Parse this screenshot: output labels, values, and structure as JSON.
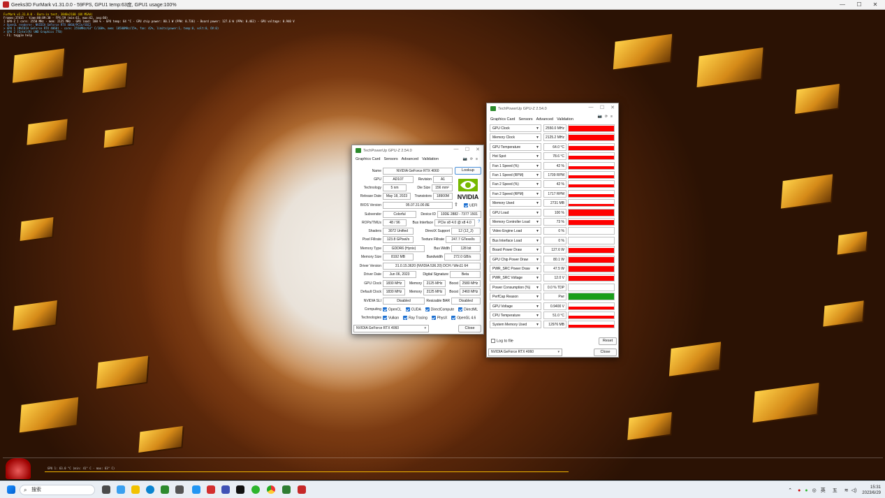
{
  "furmark": {
    "title": "Geeks3D FurMark v1.31.0.0 - 59FPS, GPU1 temp:63度, GPU1 usage:100%",
    "overlay": [
      {
        "text": "FurMark v1.31.0.0 - Burn-in test, 3840x2160 (0X MSAA)",
        "color": "#ffe600"
      },
      {
        "text": "Frames:37415 - time:00:09:30 - FPS:59 (min:61, max:62, avg:60)",
        "color": "#ffffff"
      },
      {
        "text": "[ GPU-Z ] core: 2550 MHz - mem: 2125 MHz - GPU load: 100 % - GPU temp: 64 °C - GPU chip power: 80.1 W (PPW: 0.736) - Board power: 127.6 W (PPW: 0.462) - GPU voltage: 0.940 V",
        "color": "#ffffff"
      },
      {
        "text": "> OpenGL renderer: NVIDIA GeForce RTX 4060/PCIe/SSE2",
        "color": "#66b3ff"
      },
      {
        "text": "> GPU 1 (NVIDIA GeForce RTX 4060) - core: 2550MHz/63° C/100%, mem: 10500MHz/15%, fan: 42%, limits(power:1, temp:0, volt:0, OV:0)",
        "color": "#66ccff"
      },
      {
        "text": "> GPU 2 (Intel(R) UHD Graphics 770)",
        "color": "#66ccff"
      },
      {
        "text": "- F1: toggle help",
        "color": "#ffffff"
      }
    ],
    "graph_label": "GPU 1: 63.0 °C (min: 41° C - max: 63° C)",
    "window_controls": [
      "—",
      "☐",
      "✕"
    ]
  },
  "gpuz_card": {
    "title": "TechPowerUp GPU-Z 2.54.0",
    "tabs": [
      "Graphics Card",
      "Sensors",
      "Advanced",
      "Validation"
    ],
    "active_tab": "Graphics Card",
    "name": "NVIDIA GeForce RTX 4060",
    "lookup": "Lookup",
    "gpu": "AD107",
    "revision_label": "Revision",
    "revision": "A1",
    "technology": "5 nm",
    "die_size_label": "Die Size",
    "die_size": "156 mm²",
    "release_date": "May 18, 2023",
    "transistors_label": "Transistors",
    "transistors": "18900M",
    "bios_version": "95.07.31.00.8E",
    "uefi": "UEFI",
    "subvendor": "Colorful",
    "device_id_label": "Device ID",
    "device_id": "10DE 2882 - 7377 1501",
    "rops_tmus": "48 / 96",
    "bus_interface_label": "Bus Interface",
    "bus_interface": "PCIe x8 4.0 @ x8 4.0",
    "help": "?",
    "shaders": "3072 Unified",
    "directx_label": "DirectX Support",
    "directx": "12 (12_2)",
    "pixel_fillrate": "123.8 GPixel/s",
    "texture_fillrate_label": "Texture Fillrate",
    "texture_fillrate": "247.7 GTexel/s",
    "memory_type": "GDDR6 (Hynix)",
    "bus_width_label": "Bus Width",
    "bus_width": "128 bit",
    "memory_size": "8192 MB",
    "bandwidth_label": "Bandwidth",
    "bandwidth": "272.0 GB/s",
    "driver_version": "31.0.15.3620 (NVIDIA 536.20) DCH / Win11 64",
    "driver_date": "Jun 06, 2023",
    "digital_signature_label": "Digital Signature",
    "digital_signature": "Beta",
    "gpu_clock": "1830 MHz",
    "memory_label": "Memory",
    "gpu_memory": "2125 MHz",
    "boost_label": "Boost",
    "gpu_boost": "2580 MHz",
    "default_clock": "1830 MHz",
    "default_memory": "2125 MHz",
    "default_boost": "2460 MHz",
    "nvidia_sli": "Disabled",
    "resizable_bar_label": "Resizable BAR",
    "resizable_bar": "Disabled",
    "computing": [
      "OpenCL",
      "CUDA",
      "DirectCompute",
      "DirectML"
    ],
    "technologies": [
      "Vulkan",
      "Ray Tracing",
      "PhysX",
      "OpenGL 4.6"
    ],
    "labels": {
      "name": "Name",
      "gpu": "GPU",
      "technology": "Technology",
      "release_date": "Release Date",
      "bios_version": "BIOS Version",
      "subvendor": "Subvendor",
      "rops_tmus": "ROPs/TMUs",
      "shaders": "Shaders",
      "pixel_fillrate": "Pixel Fillrate",
      "memory_type": "Memory Type",
      "memory_size": "Memory Size",
      "driver_version": "Driver Version",
      "driver_date": "Driver Date",
      "gpu_clock": "GPU Clock",
      "default_clock": "Default Clock",
      "nvidia_sli": "NVIDIA SLI",
      "computing": "Computing",
      "technologies": "Technologies"
    },
    "vendor_logo": "NVIDIA",
    "selected_gpu": "NVIDIA GeForce RTX 4060",
    "close": "Close"
  },
  "gpuz_sensors": {
    "title": "TechPowerUp GPU-Z 2.54.0",
    "tabs": [
      "Graphics Card",
      "Sensors",
      "Advanced",
      "Validation"
    ],
    "active_tab": "Sensors",
    "rows": [
      {
        "name": "GPU Clock",
        "value": "2550.0 MHz",
        "level": 0.92,
        "color": "#ff0000"
      },
      {
        "name": "Memory Clock",
        "value": "2125.2 MHz",
        "level": 0.92,
        "color": "#ff0000"
      },
      {
        "name": "GPU Temperature",
        "value": "64.0 °C",
        "level": 0.6,
        "color": "#ff0000"
      },
      {
        "name": "Hot Spot",
        "value": "78.6 °C",
        "level": 0.55,
        "color": "#ff0000"
      },
      {
        "name": "Fan 1 Speed (%)",
        "value": "42 %",
        "level": 0.45,
        "color": "#ff0000"
      },
      {
        "name": "Fan 1 Speed (RPM)",
        "value": "1709 RPM",
        "level": 0.45,
        "color": "#ff0000"
      },
      {
        "name": "Fan 2 Speed (%)",
        "value": "42 %",
        "level": 0.45,
        "color": "#ff0000"
      },
      {
        "name": "Fan 2 Speed (RPM)",
        "value": "1717 RPM",
        "level": 0.45,
        "color": "#ff0000"
      },
      {
        "name": "Memory Used",
        "value": "2731 MB",
        "level": 0.35,
        "color": "#ff0000"
      },
      {
        "name": "GPU Load",
        "value": "100 %",
        "level": 1.0,
        "color": "#ff0000"
      },
      {
        "name": "Memory Controller Load",
        "value": "73 %",
        "level": 0.73,
        "color": "#ff0000"
      },
      {
        "name": "Video Engine Load",
        "value": "0 %",
        "level": 0,
        "color": "#ff0000"
      },
      {
        "name": "Bus Interface Load",
        "value": "0 %",
        "level": 0,
        "color": "#ff0000"
      },
      {
        "name": "Board Power Draw",
        "value": "127.6 W",
        "level": 0.85,
        "color": "#ff0000"
      },
      {
        "name": "GPU Chip Power Draw",
        "value": "80.1 W",
        "level": 0.85,
        "color": "#ff0000"
      },
      {
        "name": "PWR_SRC Power Draw",
        "value": "47.5 W",
        "level": 0.85,
        "color": "#ff0000"
      },
      {
        "name": "PWR_SRC Voltage",
        "value": "12.0 V",
        "level": 0.85,
        "color": "#ff0000"
      },
      {
        "name": "Power Consumption (%)",
        "value": "0.0 % TDP",
        "level": 0,
        "color": "#ff0000"
      },
      {
        "name": "PerfCap Reason",
        "value": "Pwr",
        "level": 1.0,
        "color": "#1a9e1a"
      },
      {
        "name": "GPU Voltage",
        "value": "0.9400 V",
        "level": 0.4,
        "color": "#ff0000"
      },
      {
        "name": "CPU Temperature",
        "value": "51.0 °C",
        "level": 0.4,
        "color": "#ff0000"
      },
      {
        "name": "System Memory Used",
        "value": "12976 MB",
        "level": 0.45,
        "color": "#ff0000"
      }
    ],
    "log_to_file": "Log to file",
    "reset": "Reset",
    "selected_gpu": "NVIDIA GeForce RTX 4060",
    "close": "Close"
  },
  "taskbar": {
    "search_placeholder": "搜索",
    "ime_lang": "英",
    "ime_mode": "五",
    "time": "15:31",
    "date": "2023/6/29"
  }
}
